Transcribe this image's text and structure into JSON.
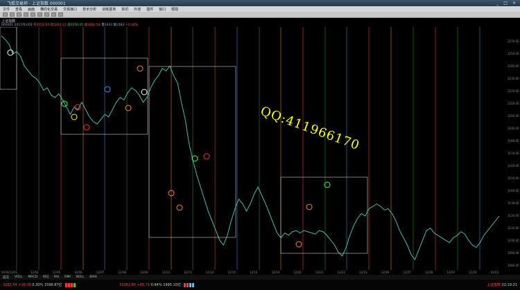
{
  "window": {
    "title": "飞狐交易师 - 上证指数 000001",
    "controls": [
      "_",
      "□",
      "×"
    ]
  },
  "menu": [
    "文件",
    "查看",
    "画面",
    "横向化交易",
    "交易接口",
    "技术分析",
    "训练基地",
    "资讯",
    "外挂",
    "插件",
    "窗口",
    "帮助"
  ],
  "info_line1": "上证指数",
  "info_line2": {
    "code": "000001",
    "date": "2017/01/03",
    "open_label": "开3251.93",
    "high_label": "高3263.31",
    "low_label": "低3250.05",
    "close_label": "收3262.54",
    "vol_label": "量2043",
    "amt_label": "额3183",
    "chg": "+0.30%"
  },
  "watermark": "QQ:411966170",
  "x_labels": [
    "2016/12/01",
    "12/02",
    "12/05",
    "12/06",
    "12/07",
    "12/08",
    "12/09",
    "12/12",
    "12/13",
    "12/14",
    "12/15",
    "12/16",
    "12/19",
    "12/20",
    "12/21",
    "12/22",
    "12/23",
    "12/26",
    "12/27",
    "12/28",
    "12/29",
    "12/30",
    "01/03"
  ],
  "y_labels": [
    "3270.00",
    "3250.00",
    "3240.00",
    "3230.00",
    "3220.00",
    "3210.00",
    "3200.00",
    "3190.00",
    "3180.00",
    "3170.00",
    "3160.00",
    "3150.00",
    "3140.00",
    "3130.00",
    "3120.00",
    "3110.00",
    "3100.00",
    "3090.00",
    "3080.00"
  ],
  "subtabs": [
    "成交",
    "VOLL",
    "MACD",
    "KDJ",
    "RSI",
    "DMI",
    "BOLL",
    "BIAS"
  ],
  "status": {
    "sh_index": "3262.54",
    "sh_change": "+10.30",
    "sh_pct": "0.30%",
    "sh_amt": "1598.87亿",
    "sz_index": "10262.85",
    "sz_change": "+85.71",
    "sz_pct": "0.84%",
    "sz_amt": "1995.10亿",
    "clock": "22:19:21",
    "market": "上证指数"
  },
  "chart_data": {
    "type": "line",
    "series": [
      {
        "values": [
          3265,
          3262,
          3258,
          3250,
          3252,
          3248,
          3240,
          3236,
          3232,
          3230,
          3226,
          3220,
          3222,
          3216,
          3214,
          3217,
          3212,
          3206,
          3200,
          3206,
          3204,
          3210,
          3204,
          3198,
          3194,
          3192,
          3196,
          3200,
          3198,
          3204,
          3210,
          3214,
          3212,
          3218,
          3222,
          3220,
          3216,
          3210,
          3214,
          3222,
          3228,
          3232,
          3238,
          3236,
          3240,
          3232,
          3226,
          3210,
          3196,
          3176,
          3162,
          3150,
          3140,
          3130,
          3120,
          3112,
          3104,
          3096,
          3092,
          3100,
          3112,
          3122,
          3130,
          3126,
          3120,
          3126,
          3134,
          3140,
          3133,
          3126,
          3118,
          3110,
          3102,
          3098,
          3102,
          3100,
          3103,
          3104,
          3102,
          3104,
          3103,
          3102,
          3101,
          3104,
          3103,
          3100,
          3096,
          3092,
          3086,
          3083,
          3090,
          3100,
          3108,
          3114,
          3118,
          3116,
          3122,
          3124,
          3126,
          3124,
          3121,
          3122,
          3118,
          3112,
          3104,
          3098,
          3092,
          3084,
          3080,
          3088,
          3096,
          3104,
          3106,
          3102,
          3100,
          3098,
          3096,
          3094,
          3098,
          3100,
          3103,
          3101,
          3096,
          3092,
          3090,
          3094,
          3100,
          3104,
          3108,
          3112,
          3116
        ]
      }
    ],
    "ylim": [
      3076,
      3270
    ]
  }
}
